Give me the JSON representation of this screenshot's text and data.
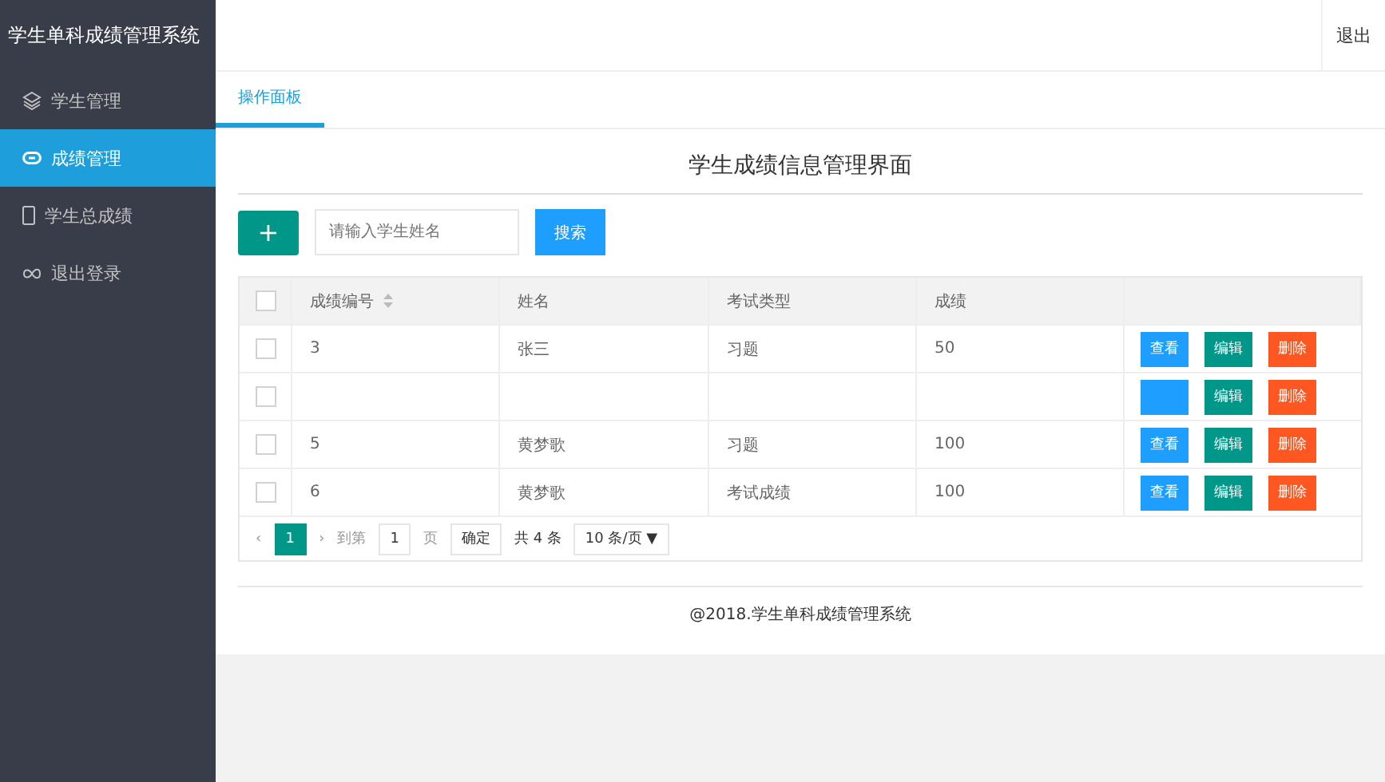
{
  "app_title": "学生单科成绩管理系统",
  "header": {
    "logout": "退出"
  },
  "sidebar": {
    "items": [
      {
        "label": "学生管理",
        "kind": "layers",
        "selected": false
      },
      {
        "label": "成绩管理",
        "kind": "link",
        "selected": true
      },
      {
        "label": "学生总成绩",
        "kind": "phone",
        "selected": false
      },
      {
        "label": "退出登录",
        "kind": "loop",
        "selected": false
      }
    ]
  },
  "tabs": [
    {
      "label": "操作面板",
      "selected": true
    }
  ],
  "page_title": "学生成绩信息管理界面",
  "toolbar": {
    "add": "+",
    "search": {
      "placeholder": "请输入学生姓名"
    },
    "search_button": "搜索"
  },
  "table": {
    "columns": [
      "成绩编号",
      "姓名",
      "考试类型",
      "成绩"
    ],
    "header_checked": false,
    "rows": [
      {
        "checked": false,
        "cells": [
          "3",
          "张三",
          "习题",
          "50"
        ],
        "actions": [
          {
            "kind": "view",
            "label": "查看"
          },
          {
            "kind": "edit",
            "label": "编辑"
          },
          {
            "kind": "delete",
            "label": "删除"
          }
        ]
      },
      {
        "checked": false,
        "cells": [],
        "actions": [
          {
            "kind": "view"
          },
          {
            "kind": "edit",
            "label": "编辑"
          },
          {
            "kind": "delete",
            "label": "删除"
          }
        ]
      },
      {
        "checked": false,
        "cells": [
          "5",
          "黄梦歌",
          "习题",
          "100"
        ],
        "actions": [
          {
            "kind": "view",
            "label": "查看"
          },
          {
            "kind": "edit",
            "label": "编辑"
          },
          {
            "kind": "delete",
            "label": "删除"
          }
        ]
      },
      {
        "checked": false,
        "cells": [
          "6",
          "黄梦歌",
          "考试成绩",
          "100"
        ],
        "actions": [
          {
            "kind": "view",
            "label": "查看"
          },
          {
            "kind": "edit",
            "label": "编辑"
          },
          {
            "kind": "delete",
            "label": "删除"
          }
        ]
      }
    ]
  },
  "pagination": {
    "prev": "‹",
    "pages": [
      {
        "label": "1",
        "selected": true
      }
    ],
    "next": "›",
    "goto_label": "到第",
    "page_value": "1",
    "page_unit": "页",
    "confirm": "确定",
    "total": "共 4 条",
    "page_size": "10 条/页 ▼"
  },
  "footer": "@2018.学生单科成绩管理系统"
}
